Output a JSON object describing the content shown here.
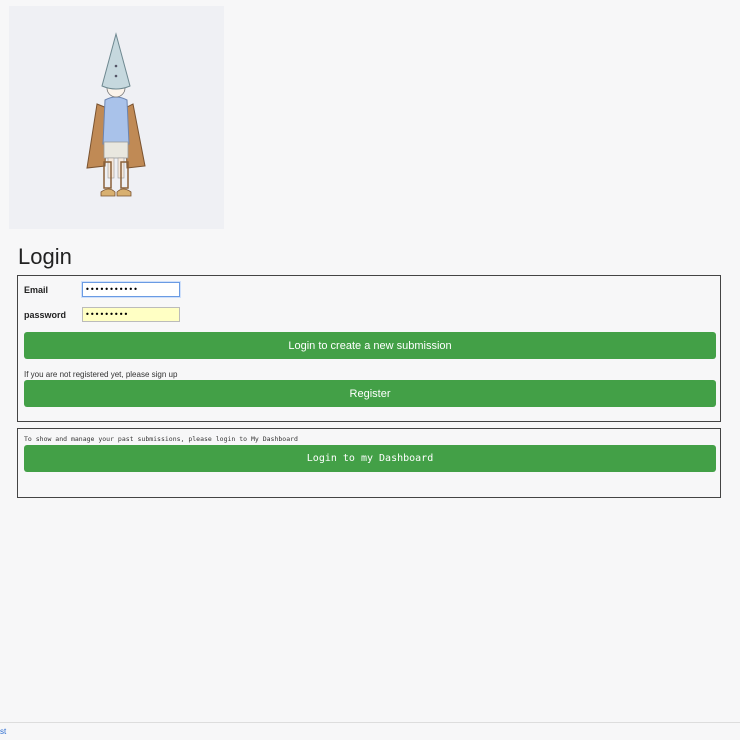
{
  "logo": {
    "icon": "gnome-with-cone-hat-illustration"
  },
  "page": {
    "title": "Login"
  },
  "login_form": {
    "email_label": "Email",
    "email_value": "•••••••••••",
    "password_label": "password",
    "password_value": "•••••••••",
    "login_button": "Login to create a new submission",
    "register_hint": "If you are not registered yet, please sign up",
    "register_button": "Register"
  },
  "dashboard": {
    "hint": "To show and manage your past submissions, please login to My Dashboard",
    "button": "Login to my Dashboard"
  },
  "footer": {
    "link": "st"
  },
  "colors": {
    "button_green": "#43a047",
    "password_bg": "#ffffc4",
    "focus_border": "#6a9be3"
  }
}
